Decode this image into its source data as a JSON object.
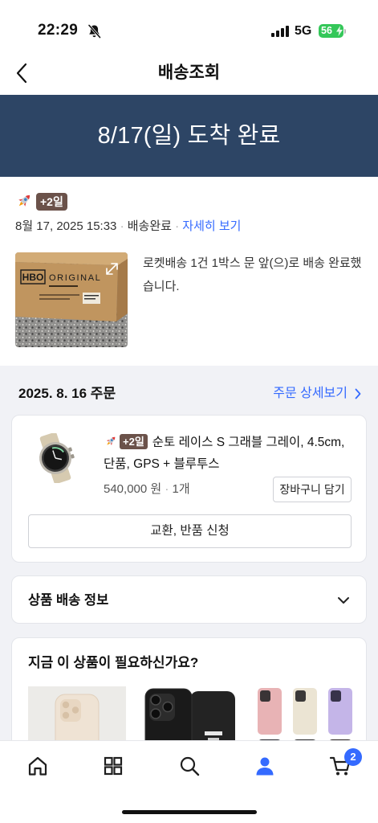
{
  "status_bar": {
    "time": "22:29",
    "network": "5G",
    "battery": "56"
  },
  "header": {
    "title": "배송조회"
  },
  "banner": {
    "text": "8/17(일) 도착 완료"
  },
  "delivery": {
    "badge": "+2일",
    "datetime": "8월 17, 2025 15:33",
    "separator": "·",
    "status": "배송완료",
    "detail_link": "자세히 보기",
    "photo_label": {
      "brand": "HBO",
      "line": "ORIGINAL"
    },
    "message": "로켓배송 1건 1박스 문 앞(으)로 배송 완료했습니다."
  },
  "order": {
    "date": "2025. 8. 16 주문",
    "detail_link": "주문 상세보기",
    "product": {
      "badge": "+2일",
      "name": "순토 레이스 S 그래블 그레이, 4.5cm, 단품, GPS + 블루투스",
      "price": "540,000 원",
      "separator": "·",
      "quantity": "1개",
      "cart_button": "장바구니 담기"
    },
    "return_button": "교환, 반품 신청"
  },
  "shipping_info": {
    "title": "상품 배송 정보",
    "expanded": false
  },
  "recommend": {
    "title": "지금 이 상품이 필요하신가요?",
    "items": [
      {
        "icon": "beige-phone-case-icon"
      },
      {
        "icon": "black-phone-case-icon"
      },
      {
        "icon": "color-phone-cases-icon"
      }
    ]
  },
  "bottom_nav": {
    "items": [
      {
        "icon": "home-icon"
      },
      {
        "icon": "category-icon"
      },
      {
        "icon": "search-icon"
      },
      {
        "icon": "my-page-icon",
        "active": true
      },
      {
        "icon": "cart-icon"
      }
    ],
    "cart_badge": "2"
  },
  "colors": {
    "accent": "#346aff",
    "banner": "#2d4565",
    "badge": "#6b524a",
    "battery": "#34c759",
    "page_bg": "#f1f2f6"
  }
}
